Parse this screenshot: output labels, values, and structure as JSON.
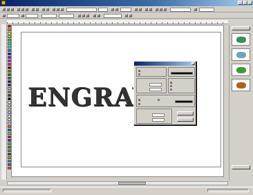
{
  "engrave_text": "ENGRAVE",
  "palette": [
    "#ff0000",
    "#ff8000",
    "#ffff00",
    "#80ff00",
    "#00ff00",
    "#00ff80",
    "#00ffff",
    "#0080ff",
    "#0000ff",
    "#8000ff",
    "#ff00ff",
    "#ff0080",
    "#800000",
    "#808000",
    "#008000",
    "#008080",
    "#000080",
    "#800080",
    "#c0c0c0",
    "#808080",
    "#404040",
    "#000000",
    "#ffffff",
    "#ffc0c0",
    "#c0ffc0",
    "#c0c0ff",
    "#ffffc0",
    "#c0ffff",
    "#ffc0ff",
    "#e06000",
    "#0060e0",
    "#60e000",
    "#e00060",
    "#6000e0",
    "#00e060",
    "#a05020",
    "#20a050",
    "#5020a0",
    "#a0a020",
    "#20a0a0",
    "#a020a0",
    "#ff4040"
  ],
  "thumb_colors": [
    "#3a8f5a",
    "#6ca2c0",
    "#3e9a38",
    "#b06020"
  ]
}
